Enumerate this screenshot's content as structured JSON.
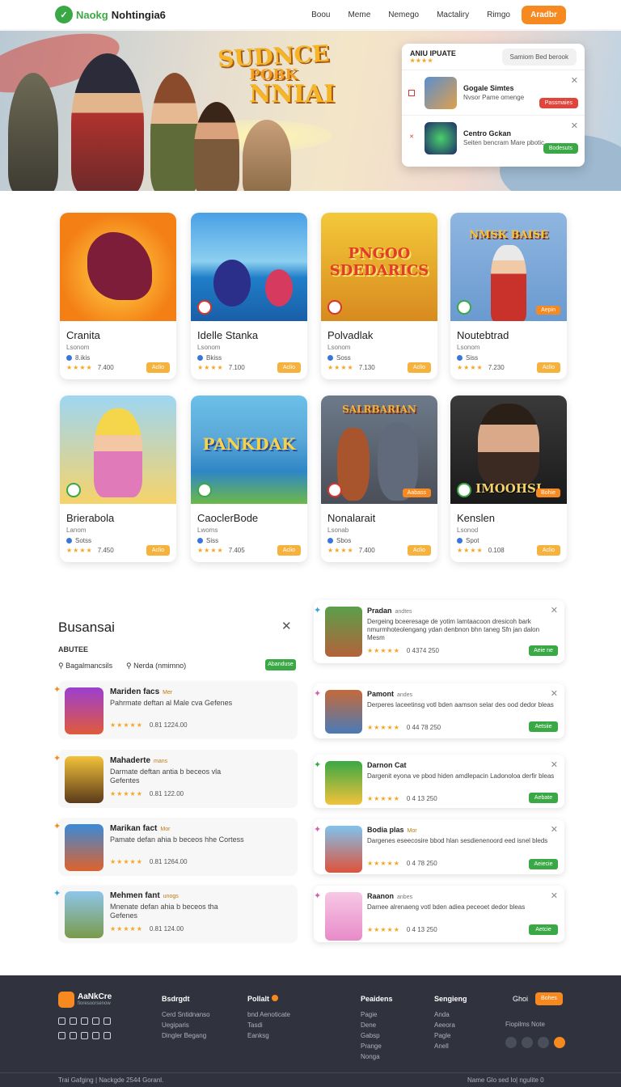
{
  "nav": {
    "logo_a": "Naokg",
    "logo_b": "Nohtingia6",
    "links": [
      "Boou",
      "Meme",
      "Nemego",
      "Mactaliry",
      "Rimgo"
    ],
    "cta": "Aradbr"
  },
  "hero": {
    "title_lines": [
      "SUDNCE",
      "POBK",
      "NNIAI"
    ],
    "popup": {
      "tab_label": "ANIU IPUATE",
      "tab_stars": "★★★★",
      "search_placeholder": "Samiom Bed berook",
      "items": [
        {
          "title": "Gogale  Simtes",
          "sub": "Nvsor Pame omenge",
          "button": "Passmaies"
        },
        {
          "title": "Centro Gckan",
          "sub": "Seiten bencram Mare pbotic",
          "button": "Bodesuts"
        }
      ]
    }
  },
  "games": [
    {
      "name": "Cranita",
      "dev": "Lsonom",
      "downloads": "8.ikis",
      "rating": "7.400",
      "art_text": ""
    },
    {
      "name": "Idelle Stanka",
      "dev": "Lsonom",
      "downloads": "Bkiss",
      "rating": "7.100",
      "art_text": ""
    },
    {
      "name": "Polvadlak",
      "dev": "Lsonom",
      "downloads": "Soss",
      "rating": "7.130",
      "art_text": "PNGOO SDEDARICS"
    },
    {
      "name": "Noutebtrad",
      "dev": "Lsonom",
      "downloads": "Siss",
      "rating": "7.230",
      "art_text": "NMSK  BAISE",
      "tag": "Aepin"
    },
    {
      "name": "Brierabola",
      "dev": "Lanom",
      "downloads": "Sotss",
      "rating": "7.450",
      "art_text": ""
    },
    {
      "name": "CaoclerBode",
      "dev": "Lwoms",
      "downloads": "Siss",
      "rating": "7.405",
      "art_text": "PANKDAK"
    },
    {
      "name": "Nonalarait",
      "dev": "Lsonab",
      "downloads": "Sbos",
      "rating": "7.400",
      "art_text": "SALRBARIAN",
      "tag": "Aabass"
    },
    {
      "name": "Kenslen",
      "dev": "Lsonod",
      "downloads": "Spot",
      "rating": "0.108",
      "art_text": "IMOOHSI",
      "tag": "Bohie"
    }
  ],
  "bestsellers": {
    "title": "Busansai",
    "subtitle": "ABUTEE",
    "filters": [
      "Bagalmancsils",
      "Nerda (nmimno)"
    ],
    "button": "Abanduse",
    "items": [
      {
        "name": "Mariden facs",
        "mini": "Mer",
        "desc": "Pahrmate deftan al Male cva Gefenes",
        "rating": "0.81 1224.00"
      },
      {
        "name": "Mahaderte",
        "mini": "mans",
        "desc": "Darmate deftan antia b beceos vla Gefentes",
        "rating": "0.81 122.00"
      },
      {
        "name": "Marikan fact",
        "mini": "Mor",
        "desc": "Pamate defan ahia b beceos hhe Cortess",
        "rating": "0.81 1264.00"
      },
      {
        "name": "Mehmen fant",
        "mini": "unogs",
        "desc": "Mnenate defan ahia b beceos tha Gefenes",
        "rating": "0.81 124.00"
      }
    ]
  },
  "updates": [
    {
      "name": "Pradan",
      "mini": "andtes",
      "desc": "Dergeing bceeresage de yotim lamtaacoon dresicoh bark nmurmhoteolengang ydan denbnon bhn taneg Sfn jan dalon Mesm",
      "rating": "0 4374 250",
      "button": "Aeie ne"
    },
    {
      "name": "Pamont",
      "mini": "andes",
      "desc": "Derperes laceetinsg votl bden aamson selar des ood dedor bleas",
      "rating": "0 44 78 250",
      "button": "Aetsiie"
    },
    {
      "name": "Darnon Cat",
      "mini": "",
      "desc": "Dargenit eyona ve pbod hiden amdlepacin Ladonoloa derfir bleas",
      "rating": "0 4 13 250",
      "button": "Aebate"
    },
    {
      "name": "Bodia plas",
      "mini": "Mor",
      "desc": "Dargenes eseecosire bbod hlan sesdienenoord eed isnel bleds",
      "rating": "0 4 78 250",
      "button": "Aeiecie"
    },
    {
      "name": "Raanon",
      "mini": "anbes",
      "desc": "Darnee alrenaeng votl bden adiea peceoet dedor bleas",
      "rating": "0 4 13 250",
      "button": "Aetcie"
    }
  ],
  "footer": {
    "brand": "AaNkCre",
    "brand_sub": "fioresoorsenow",
    "columns": [
      {
        "head": "Bsdrgdt",
        "links": [
          "Cerd Sntidnanso",
          "Uegiparis",
          "Dingler Begang"
        ]
      },
      {
        "head": "Pollalt",
        "links": [
          "bnd Aenoticate",
          "Tasdi",
          "Eanksg"
        ]
      },
      {
        "head": "Peaidens",
        "links": [
          "Pagie",
          "Dene",
          "Gabsp",
          "Prange",
          "Nonga"
        ]
      },
      {
        "head": "Sengieng",
        "links": [
          "Anda",
          "Aeeora",
          "Pagle",
          "Anell"
        ]
      }
    ],
    "ghost_label": "Ghoi",
    "button": "Bohes",
    "note": "Fiopilms Note",
    "copyright": "Trai Gafging | Nackgde 2544 Goranl.",
    "legal": "Name Glo sed Io| ngulite 0"
  },
  "colors": {
    "accent": "#f6891f",
    "green": "#3aa845",
    "star": "#f5a623",
    "footer": "#30323d"
  }
}
